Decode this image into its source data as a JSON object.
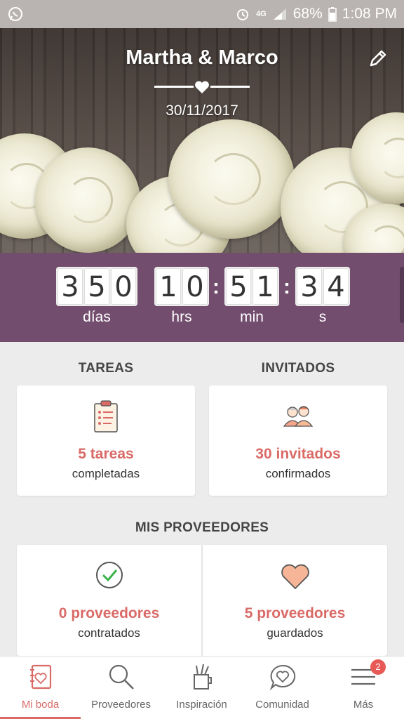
{
  "status_bar": {
    "left_icon": "whatsapp-icon",
    "icons": [
      "alarm-icon",
      "4g-icon",
      "signal-icon"
    ],
    "battery": "68%",
    "time": "1:08 PM"
  },
  "hero": {
    "couple_names": "Martha & Marco",
    "date": "30/11/2017",
    "edit_icon": "pencil-icon"
  },
  "countdown": {
    "days": [
      "3",
      "5",
      "0"
    ],
    "hours": [
      "1",
      "0"
    ],
    "minutes": [
      "5",
      "1"
    ],
    "seconds": [
      "3",
      "4"
    ],
    "labels": {
      "days": "días",
      "hours": "hrs",
      "minutes": "min",
      "seconds": "s"
    }
  },
  "tareas": {
    "title": "TAREAS",
    "value": "5 tareas",
    "sub": "completadas",
    "icon": "clipboard-checklist-icon"
  },
  "invitados": {
    "title": "INVITADOS",
    "value": "30 invitados",
    "sub": "confirmados",
    "icon": "guests-icon"
  },
  "proveedores": {
    "title": "MIS PROVEEDORES",
    "contratados": {
      "value": "0 proveedores",
      "sub": "contratados",
      "icon": "check-circle-icon"
    },
    "guardados": {
      "value": "5 proveedores",
      "sub": "guardados",
      "icon": "heart-icon"
    }
  },
  "bottom_nav": {
    "items": [
      {
        "label": "Mi boda",
        "icon": "notebook-icon",
        "active": true
      },
      {
        "label": "Proveedores",
        "icon": "search-icon",
        "active": false
      },
      {
        "label": "Inspiración",
        "icon": "pencil-cup-icon",
        "active": false
      },
      {
        "label": "Comunidad",
        "icon": "chat-heart-icon",
        "active": false
      },
      {
        "label": "Más",
        "icon": "menu-icon",
        "active": false,
        "badge": "2"
      }
    ]
  },
  "colors": {
    "accent": "#d96a66",
    "countdown_bg": "#734d6e",
    "status_bar": "#b9b4b1"
  }
}
